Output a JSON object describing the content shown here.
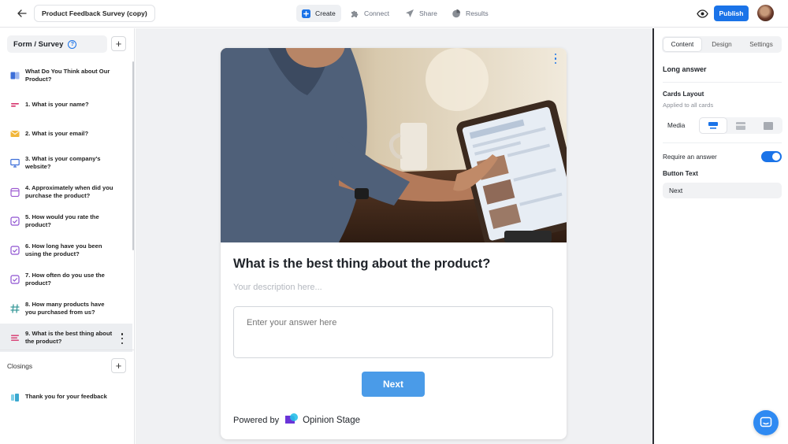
{
  "topbar": {
    "title": "Product Feedback Survey (copy)",
    "nav": [
      {
        "label": "Create",
        "icon": "create-plus-icon",
        "active": true
      },
      {
        "label": "Connect",
        "icon": "puzzle-icon",
        "active": false
      },
      {
        "label": "Share",
        "icon": "send-icon",
        "active": false
      },
      {
        "label": "Results",
        "icon": "pie-chart-icon",
        "active": false
      }
    ],
    "publish_label": "Publish",
    "accent": "#1a73e8"
  },
  "sidebar": {
    "header": "Form / Survey",
    "items": [
      {
        "label": "What Do You Think about Our Product?",
        "icon": "cover-icon"
      },
      {
        "label": "1. What is your name?",
        "icon": "short-text-icon"
      },
      {
        "label": "2. What is your email?",
        "icon": "envelope-icon"
      },
      {
        "label": "3. What is your company's website?",
        "icon": "monitor-icon"
      },
      {
        "label": "4. Approximately when did you purchase the product?",
        "icon": "calendar-icon"
      },
      {
        "label": "5. How would you rate the product?",
        "icon": "checkbox-icon"
      },
      {
        "label": "6. How long have you been using the product?",
        "icon": "checkbox-icon"
      },
      {
        "label": "7. How often do you use the product?",
        "icon": "checkbox-icon"
      },
      {
        "label": "8. How many products have you purchased from us?",
        "icon": "hash-icon"
      },
      {
        "label": "9. What is the best thing about the product?",
        "icon": "long-text-icon",
        "selected": true
      }
    ],
    "closings_label": "Closings",
    "closing_item": "Thank you for your feedback"
  },
  "card": {
    "question": "What is the best thing about the product?",
    "description_placeholder": "Your description here...",
    "answer_placeholder": "Enter your answer here",
    "next_label": "Next",
    "powered_by": "Powered by",
    "brand": "Opinion Stage",
    "button_color": "#4a9be8"
  },
  "panel": {
    "tabs": [
      "Content",
      "Design",
      "Settings"
    ],
    "active_tab": "Content",
    "type_label": "Long answer",
    "cards_layout_label": "Cards Layout",
    "cards_layout_sub": "Applied to all cards",
    "media_label": "Media",
    "require_label": "Require an answer",
    "require_on": true,
    "button_text_label": "Button Text",
    "button_text_value": "Next"
  }
}
